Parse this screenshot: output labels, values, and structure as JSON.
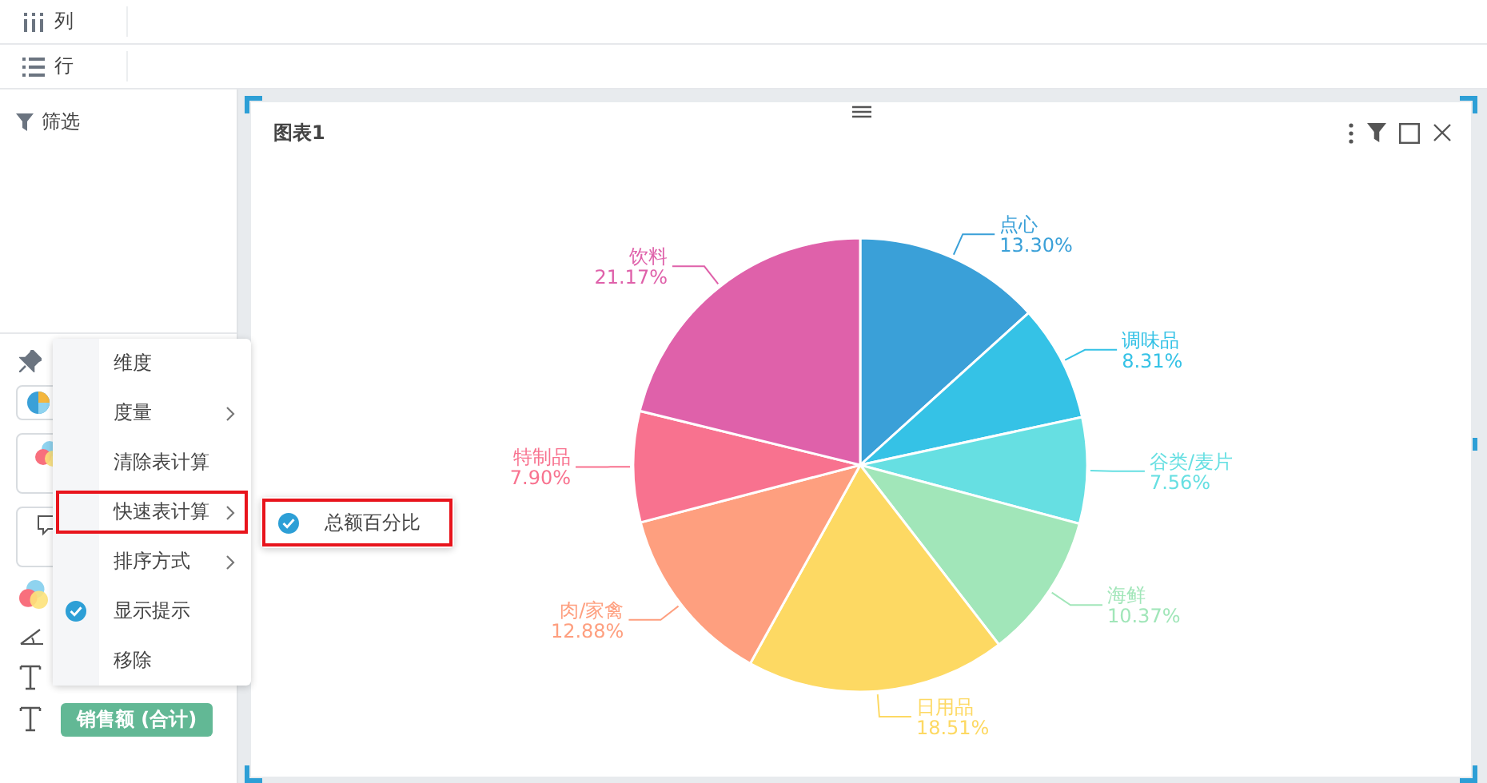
{
  "shelves": [
    {
      "kind": "columns",
      "label": "列"
    },
    {
      "kind": "rows",
      "label": "行"
    }
  ],
  "filter_panel": {
    "title": "筛选"
  },
  "marks_panel": {
    "pill": "销售额 (合计)"
  },
  "context_menu": [
    {
      "label": "维度",
      "checked": false,
      "has_submenu": false,
      "highlighted": false
    },
    {
      "label": "度量",
      "checked": false,
      "has_submenu": true,
      "highlighted": false
    },
    {
      "label": "清除表计算",
      "checked": false,
      "has_submenu": false,
      "highlighted": false
    },
    {
      "label": "快速表计算",
      "checked": false,
      "has_submenu": true,
      "highlighted": true
    },
    {
      "label": "排序方式",
      "checked": false,
      "has_submenu": true,
      "highlighted": false
    },
    {
      "label": "显示提示",
      "checked": true,
      "has_submenu": false,
      "highlighted": false
    },
    {
      "label": "移除",
      "checked": false,
      "has_submenu": false,
      "highlighted": false
    }
  ],
  "submenu": [
    {
      "label": "总额百分比",
      "checked": true,
      "highlighted": true
    }
  ],
  "chart_card": {
    "title": "图表1",
    "chart_data": {
      "type": "pie",
      "categories": [
        "点心",
        "调味品",
        "谷类/麦片",
        "海鲜",
        "日用品",
        "肉/家禽",
        "特制品",
        "饮料"
      ],
      "values": [
        13.3,
        8.31,
        7.56,
        10.37,
        18.51,
        12.88,
        7.9,
        21.17
      ],
      "value_labels": [
        "13.30%",
        "8.31%",
        "7.56%",
        "10.37%",
        "18.51%",
        "12.88%",
        "7.90%",
        "21.17%"
      ]
    }
  }
}
